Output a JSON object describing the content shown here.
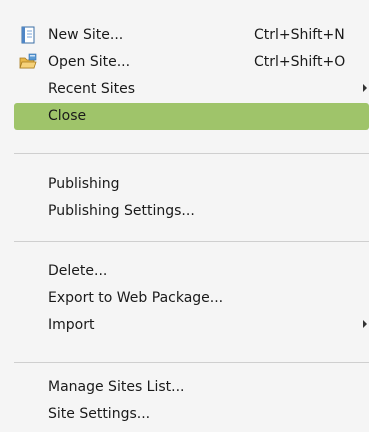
{
  "menu": {
    "items": [
      {
        "label": "New Site...",
        "shortcut": "Ctrl+Shift+N",
        "icon": "new-site-icon"
      },
      {
        "label": "Open Site...",
        "shortcut": "Ctrl+Shift+O",
        "icon": "open-folder-icon"
      },
      {
        "label": "Recent Sites",
        "submenu": true
      },
      {
        "label": "Close",
        "highlighted": true
      },
      {
        "label": "Publishing"
      },
      {
        "label": "Publishing Settings..."
      },
      {
        "label": "Delete..."
      },
      {
        "label": "Export to Web Package..."
      },
      {
        "label": "Import",
        "submenu": true
      },
      {
        "label": "Manage Sites List..."
      },
      {
        "label": "Site Settings..."
      }
    ]
  },
  "colors": {
    "menu_background": "#f5f5f5",
    "highlight": "#9fc46a",
    "separator": "#cfcfcf"
  }
}
